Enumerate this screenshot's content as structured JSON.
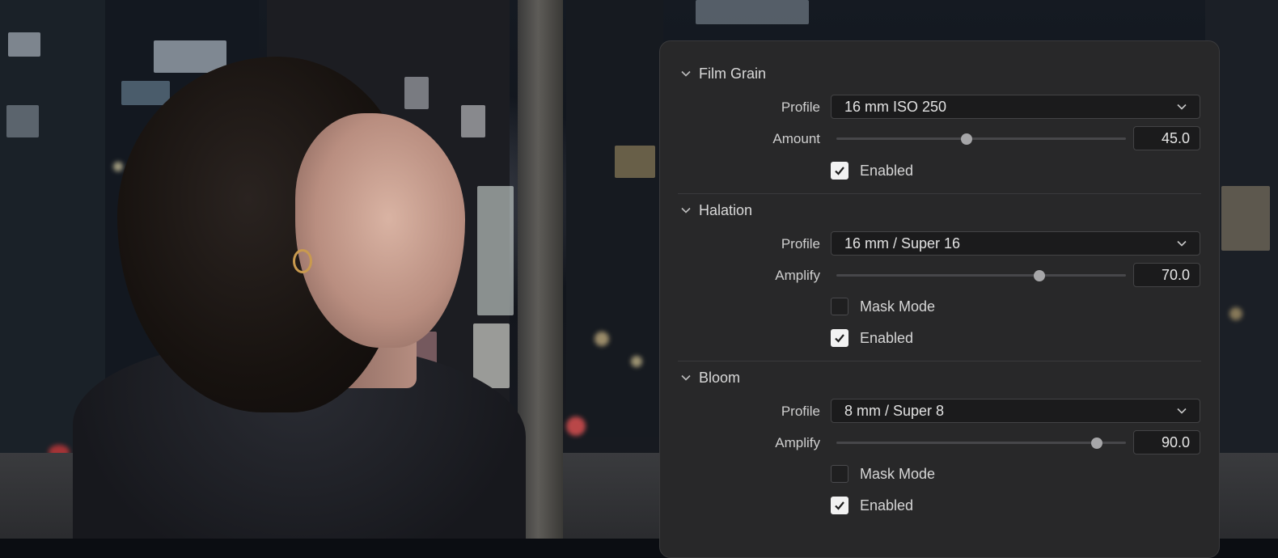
{
  "panel": {
    "sections": [
      {
        "title": "Film Grain",
        "profile_label": "Profile",
        "profile_value": "16 mm ISO 250",
        "slider_label": "Amount",
        "slider_value": "45.0",
        "slider_fraction": 0.45,
        "enabled_label": "Enabled",
        "enabled": true
      },
      {
        "title": "Halation",
        "profile_label": "Profile",
        "profile_value": "16 mm / Super 16",
        "slider_label": "Amplify",
        "slider_value": "70.0",
        "slider_fraction": 0.7,
        "mask_label": "Mask Mode",
        "mask_mode": false,
        "enabled_label": "Enabled",
        "enabled": true
      },
      {
        "title": "Bloom",
        "profile_label": "Profile",
        "profile_value": "8 mm / Super 8",
        "slider_label": "Amplify",
        "slider_value": "90.0",
        "slider_fraction": 0.9,
        "mask_label": "Mask Mode",
        "mask_mode": false,
        "enabled_label": "Enabled",
        "enabled": true
      }
    ]
  },
  "icons": {
    "section_toggle": "chevron-down-icon",
    "dropdown": "chevron-down-icon",
    "checkmark": "checkmark-icon"
  },
  "colors": {
    "panel_bg": "#282829",
    "field_bg": "#1b1b1c",
    "checkbox_on": "#f2f2f2",
    "slider_thumb": "#a6a6a8"
  }
}
